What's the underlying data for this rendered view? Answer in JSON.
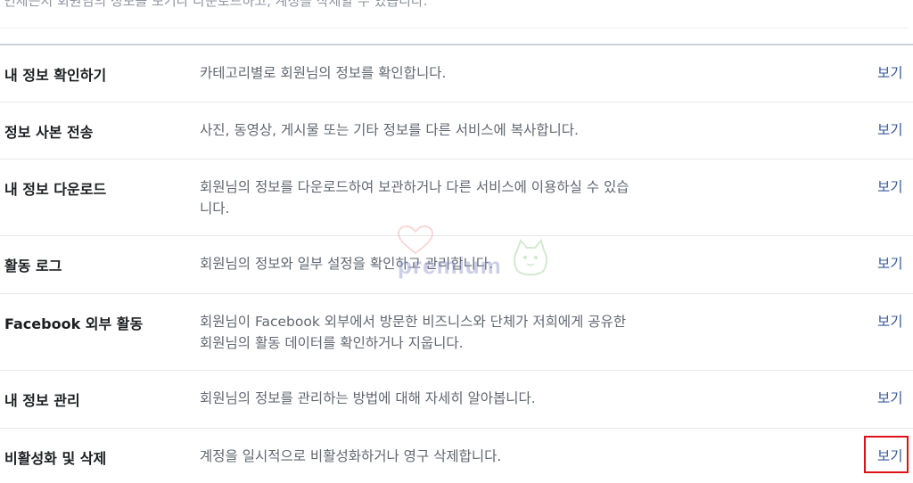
{
  "intro": {
    "text": "언제든지 회원님의 정보를 보거나 다운로드하고, 계정을 삭제할 수 있습니다."
  },
  "rows": [
    {
      "title": "내 정보 확인하기",
      "description": "카테고리별로 회원님의 정보를 확인합니다.",
      "action": "보기"
    },
    {
      "title": "정보 사본 전송",
      "description": "사진, 동영상, 게시물 또는 기타 정보를 다른 서비스에 복사합니다.",
      "action": "보기"
    },
    {
      "title": "내 정보 다운로드",
      "description": "회원님의 정보를 다운로드하여 보관하거나 다른 서비스에 이용하실 수 있습니다.",
      "action": "보기"
    },
    {
      "title": "활동 로그",
      "description": "회원님의 정보와 일부 설정을 확인하고 관리합니다.",
      "action": "보기"
    },
    {
      "title": "Facebook 외부 활동",
      "description": "회원님이 Facebook 외부에서 방문한 비즈니스와 단체가 저희에게 공유한 회원님의 활동 데이터를 확인하거나 지웁니다.",
      "action": "보기"
    },
    {
      "title": "내 정보 관리",
      "description": "회원님의 정보를 관리하는 방법에 대해 자세히 알아봅니다.",
      "action": "보기"
    },
    {
      "title": "비활성화 및 삭제",
      "description": "계정을 일시적으로 비활성화하거나 영구 삭제합니다.",
      "action": "보기"
    }
  ],
  "watermark": {
    "text": "premium",
    "icon": "heart-icon"
  },
  "colors": {
    "link": "#385898",
    "highlight": "#e0101a"
  }
}
